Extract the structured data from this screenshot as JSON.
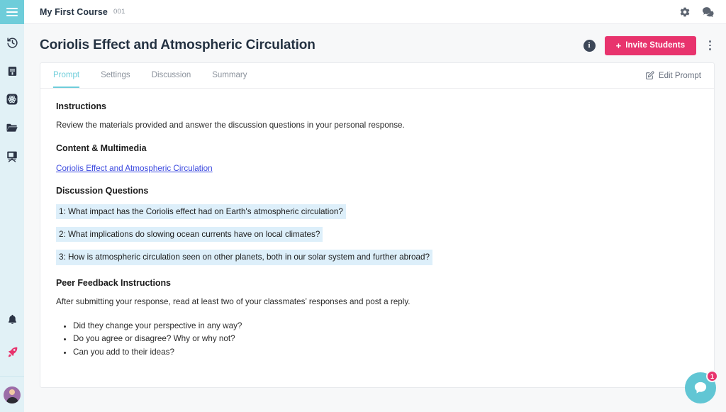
{
  "sidebar": {
    "menu_icon": "hamburger-menu-icon",
    "items": [
      {
        "icon": "history-clock-icon",
        "name": "history"
      },
      {
        "icon": "book-icon",
        "name": "library"
      },
      {
        "icon": "atom-icon",
        "name": "science"
      },
      {
        "icon": "folder-icon",
        "name": "files"
      },
      {
        "icon": "presentation-easel-icon",
        "name": "classroom"
      }
    ],
    "bottom_items": [
      {
        "icon": "bell-icon",
        "name": "notifications"
      },
      {
        "icon": "rocket-icon",
        "name": "launch"
      }
    ],
    "avatar": "user-avatar"
  },
  "topbar": {
    "course_name": "My First Course",
    "course_code": "001",
    "icons": [
      {
        "icon": "gear-icon",
        "name": "settings"
      },
      {
        "icon": "chat-bubbles-icon",
        "name": "messages"
      }
    ]
  },
  "page": {
    "title": "Coriolis Effect and Atmospheric Circulation",
    "info_label": "i",
    "invite_button": "Invite Students",
    "invite_plus": "+",
    "kebab": "more-options"
  },
  "tabs": [
    {
      "label": "Prompt",
      "active": true
    },
    {
      "label": "Settings",
      "active": false
    },
    {
      "label": "Discussion",
      "active": false
    },
    {
      "label": "Summary",
      "active": false
    }
  ],
  "edit_prompt": {
    "label": "Edit Prompt",
    "icon": "pencil-square-icon"
  },
  "content": {
    "instructions_heading": "Instructions",
    "instructions_text": "Review the materials provided and answer the discussion questions in your personal response.",
    "content_heading": "Content & Multimedia",
    "content_link": "Coriolis Effect and Atmospheric Circulation",
    "questions_heading": "Discussion Questions",
    "questions": [
      "1: What impact has the Coriolis effect had on Earth's atmospheric circulation?",
      "2: What implications do slowing ocean currents have on local climates?",
      "3: How is atmospheric circulation seen on other planets, both in our solar system and further abroad?"
    ],
    "peer_heading": "Peer Feedback Instructions",
    "peer_text": "After submitting your response, read at least two of your classmates’ responses and post a reply.",
    "peer_bullets": [
      "Did they change your perspective in any way?",
      "Do you agree or disagree? Why or why not?",
      "Can you add to their ideas?"
    ]
  },
  "chat": {
    "badge_count": "1",
    "icon": "chat-bubble-icon"
  },
  "colors": {
    "teal": "#6ecdda",
    "sidebar_bg": "#e1f1f6",
    "pink": "#e8336d",
    "link": "#3b49df",
    "highlight": "#ddeffa",
    "text_dark": "#243242"
  }
}
